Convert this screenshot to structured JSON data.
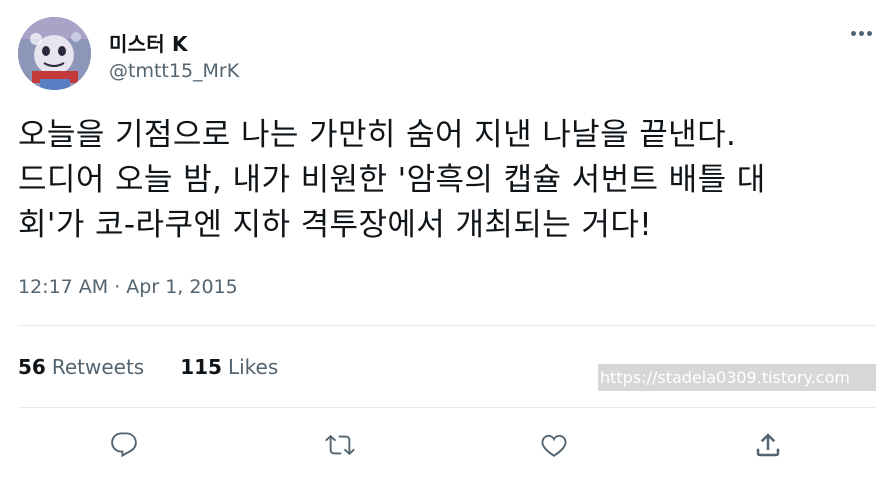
{
  "user": {
    "display_name": "미스터 K",
    "handle": "@tmtt15_MrK",
    "avatar_icon": "cartoon-avatar"
  },
  "tweet": {
    "text_lines": [
      "오늘을 기점으로 나는 가만히 숨어 지낸 나날을 끝낸다.",
      "드디어 오늘 밤, 내가 비원한 '암흑의 캡슐 서번트 배틀 대",
      "회'가 코-라쿠엔 지하 격투장에서 개최되는 거다!"
    ],
    "timestamp": "12:17 AM · Apr 1, 2015"
  },
  "stats": {
    "retweets_count": "56",
    "retweets_label": "Retweets",
    "likes_count": "115",
    "likes_label": "Likes"
  },
  "watermark": "https://stadela0309.tistory.com",
  "actions": {
    "reply_icon": "reply-icon",
    "retweet_icon": "retweet-icon",
    "like_icon": "heart-icon",
    "share_icon": "share-icon",
    "more_icon": "more-icon"
  },
  "colors": {
    "text": "#0f1419",
    "secondary": "#536471",
    "divider": "#e6ebee"
  }
}
